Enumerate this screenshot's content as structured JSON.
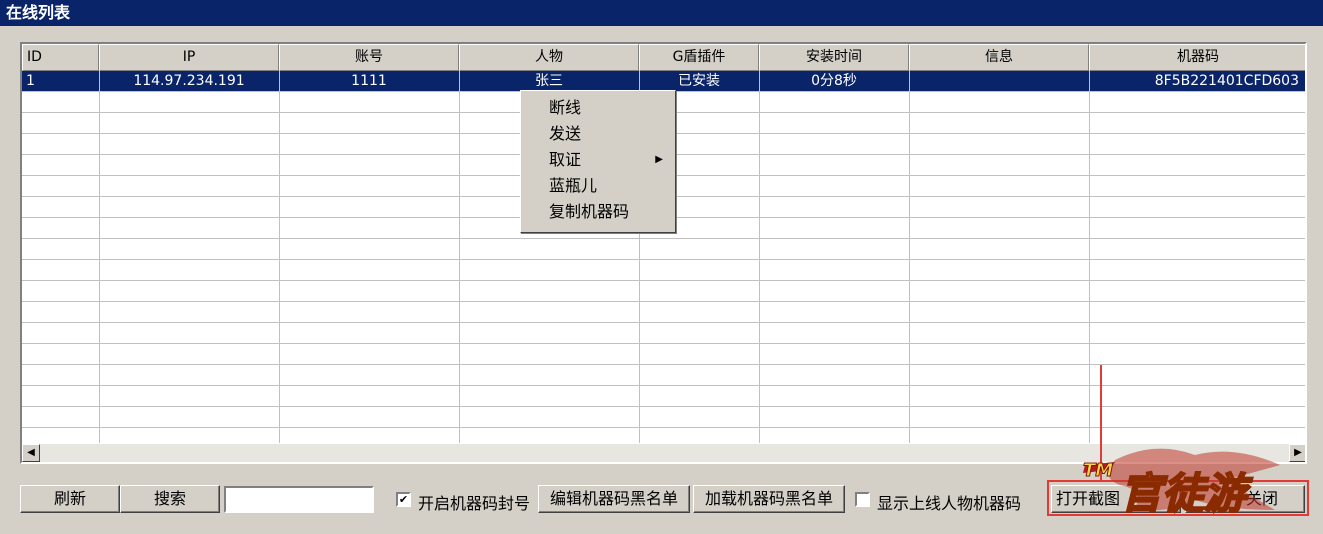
{
  "window": {
    "title": "在线列表"
  },
  "table": {
    "columns": [
      "ID",
      "IP",
      "账号",
      "人物",
      "G盾插件",
      "安装时间",
      "信息",
      "机器码"
    ],
    "rows": [
      {
        "id": "1",
        "ip": "114.97.234.191",
        "account": "1111",
        "character": "张三",
        "plugin": "已安装",
        "install_time": "0分8秒",
        "info": "",
        "machine_code": "8F5B221401CFD603"
      }
    ]
  },
  "context_menu": {
    "items": [
      "断线",
      "发送",
      "取证",
      "蓝瓶儿",
      "复制机器码"
    ]
  },
  "toolbar": {
    "refresh_label": "刷新",
    "search_label": "搜索",
    "search_value": "",
    "enable_block_label": "开启机器码封号",
    "enable_block_checked": true,
    "edit_blacklist_label": "编辑机器码黑名单",
    "load_blacklist_label": "加载机器码黑名单",
    "show_machine_code_label": "显示上线人物机器码",
    "show_machine_code_checked": false,
    "open_screenshot_label": "打开截图",
    "close_label": "关闭"
  },
  "watermark": {
    "text": "官徒游",
    "prefix": "TM"
  },
  "colors": {
    "title_bar": "#0a246a",
    "selection": "#0a246a",
    "highlight_box": "#e53935"
  }
}
